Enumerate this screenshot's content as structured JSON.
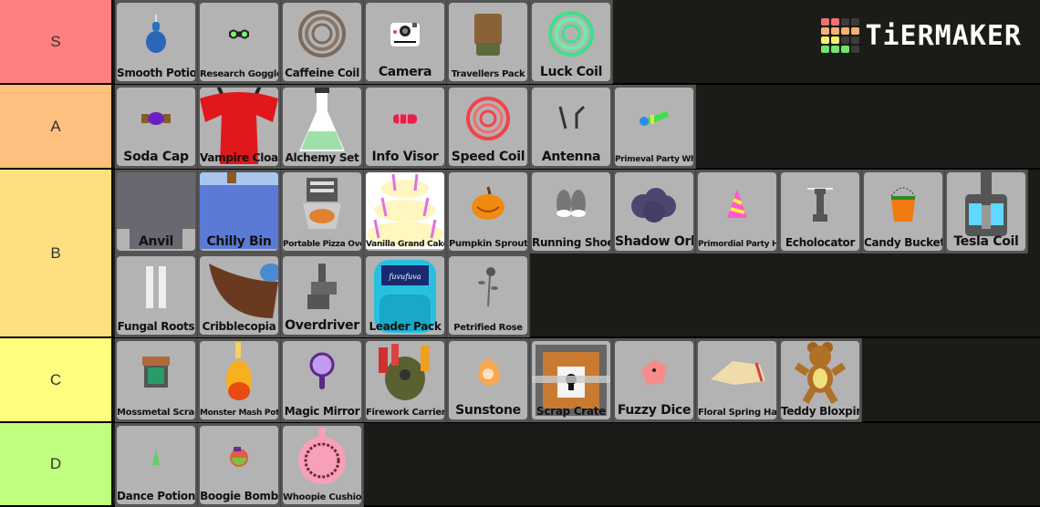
{
  "logo": {
    "text": "TiERMAKER",
    "grid_colors": [
      "#f0716f",
      "#f0716f",
      "#3c3c3c",
      "#3c3c3c",
      "#f7b074",
      "#f7b074",
      "#f7b074",
      "#f7b074",
      "#f3f06c",
      "#f3f06c",
      "#3c3c3c",
      "#3c3c3c",
      "#73e36f",
      "#73e36f",
      "#73e36f",
      "#3c3c3c"
    ]
  },
  "tiers": [
    {
      "label": "S",
      "color": "#ff7f7f",
      "rows": [
        [
          {
            "name": "Smooth Potion",
            "icon": "blue-potion-icon"
          },
          {
            "name": "Research Goggles",
            "icon": "goggles-icon"
          },
          {
            "name": "Caffeine Coil",
            "icon": "brown-coil-icon"
          },
          {
            "name": "Camera",
            "icon": "camera-icon"
          },
          {
            "name": "Travellers Pack",
            "icon": "backpack-icon"
          },
          {
            "name": "Luck Coil",
            "icon": "green-coil-icon"
          }
        ]
      ]
    },
    {
      "label": "A",
      "color": "#ffbf7f",
      "rows": [
        [
          {
            "name": "Soda Cap",
            "icon": "soda-cap-icon"
          },
          {
            "name": "Vampire Cloak",
            "icon": "vampire-cloak-icon"
          },
          {
            "name": "Alchemy Set",
            "icon": "flask-icon"
          },
          {
            "name": "Info Visor",
            "icon": "visor-icon"
          },
          {
            "name": "Speed Coil",
            "icon": "red-coil-icon"
          },
          {
            "name": "Antenna",
            "icon": "antenna-icon"
          },
          {
            "name": "Primeval Party Whistle",
            "icon": "party-whistle-icon"
          }
        ]
      ]
    },
    {
      "label": "B",
      "color": "#ffdf7f",
      "rows": [
        [
          {
            "name": "Anvil",
            "icon": "anvil-icon"
          },
          {
            "name": "Chilly Bin",
            "icon": "cooler-icon"
          },
          {
            "name": "Portable Pizza Oven",
            "icon": "pizza-oven-icon"
          },
          {
            "name": "Vanilla Grand Cake",
            "icon": "cake-icon"
          },
          {
            "name": "Pumpkin Sprout",
            "icon": "pumpkin-icon"
          },
          {
            "name": "Running Shoes",
            "icon": "shoes-icon"
          },
          {
            "name": "Shadow Orb",
            "icon": "shadow-orb-icon"
          },
          {
            "name": "Primordial Party Hat",
            "icon": "party-hat-icon"
          },
          {
            "name": "Echolocator",
            "icon": "echolocator-icon"
          },
          {
            "name": "Candy Bucket",
            "icon": "candy-bucket-icon"
          },
          {
            "name": "Tesla Coil",
            "icon": "tesla-coil-icon"
          }
        ],
        [
          {
            "name": "Fungal Roots",
            "icon": "fungal-roots-icon"
          },
          {
            "name": "Cribblecopia",
            "icon": "cornucopia-icon"
          },
          {
            "name": "Overdriver",
            "icon": "overdriver-icon"
          },
          {
            "name": "Leader Pack",
            "icon": "leader-pack-icon"
          },
          {
            "name": "Petrified Rose",
            "icon": "rose-icon"
          }
        ]
      ]
    },
    {
      "label": "C",
      "color": "#ffff7f",
      "rows": [
        [
          {
            "name": "Mossmetal Scraper",
            "icon": "scraper-icon"
          },
          {
            "name": "Monster Mash Potion",
            "icon": "orange-potion-icon"
          },
          {
            "name": "Magic Mirror",
            "icon": "mirror-icon"
          },
          {
            "name": "Firework Carrier",
            "icon": "firework-icon"
          },
          {
            "name": "Sunstone",
            "icon": "sunstone-icon"
          },
          {
            "name": "Scrap Crate",
            "icon": "crate-icon"
          },
          {
            "name": "Fuzzy Dice",
            "icon": "dice-icon"
          },
          {
            "name": "Floral Spring Hat",
            "icon": "spring-hat-icon"
          },
          {
            "name": "Teddy Bloxpin",
            "icon": "teddy-bear-icon"
          }
        ]
      ]
    },
    {
      "label": "D",
      "color": "#bfff7f",
      "rows": [
        [
          {
            "name": "Dance Potion",
            "icon": "green-potion-icon"
          },
          {
            "name": "Boogie Bomb",
            "icon": "disco-bomb-icon"
          },
          {
            "name": "Whoopie Cushion",
            "icon": "whoopie-cushion-icon"
          }
        ]
      ]
    }
  ]
}
